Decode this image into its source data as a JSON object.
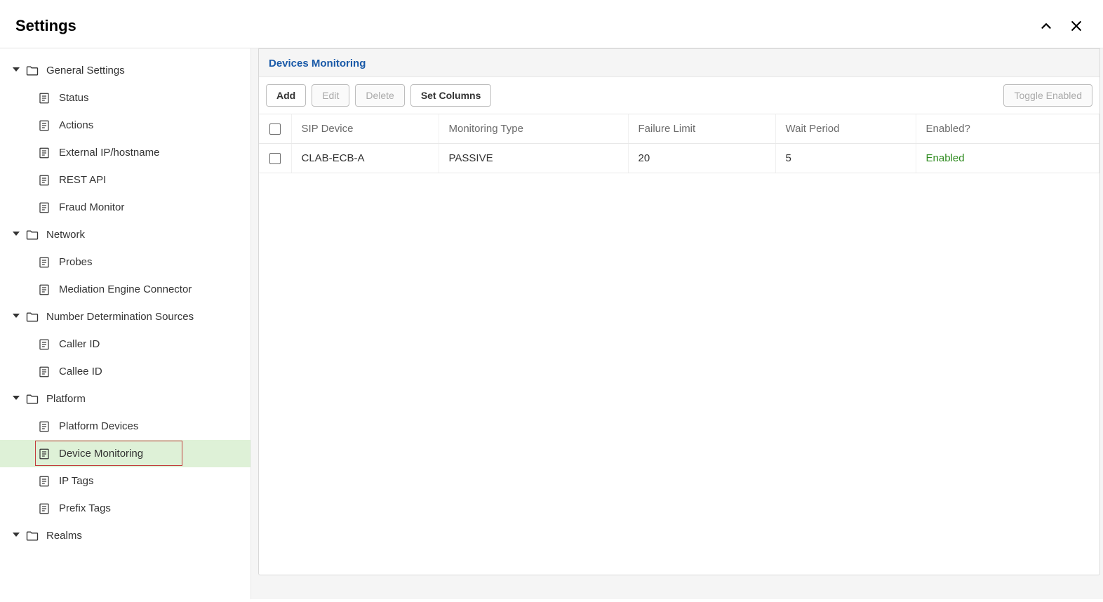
{
  "header": {
    "title": "Settings"
  },
  "sidebar": {
    "groups": [
      {
        "label": "General Settings",
        "children": [
          {
            "label": "Status"
          },
          {
            "label": "Actions"
          },
          {
            "label": "External IP/hostname"
          },
          {
            "label": "REST API"
          },
          {
            "label": "Fraud Monitor"
          }
        ]
      },
      {
        "label": "Network",
        "children": [
          {
            "label": "Probes"
          },
          {
            "label": "Mediation Engine Connector"
          }
        ]
      },
      {
        "label": "Number Determination Sources",
        "children": [
          {
            "label": "Caller ID"
          },
          {
            "label": "Callee ID"
          }
        ]
      },
      {
        "label": "Platform",
        "children": [
          {
            "label": "Platform Devices"
          },
          {
            "label": "Device Monitoring",
            "selected": true
          },
          {
            "label": "IP Tags"
          },
          {
            "label": "Prefix Tags"
          }
        ]
      },
      {
        "label": "Realms",
        "children": []
      }
    ]
  },
  "panel": {
    "title": "Devices Monitoring",
    "toolbar": {
      "add": "Add",
      "edit": "Edit",
      "delete": "Delete",
      "set_columns": "Set Columns",
      "toggle_enabled": "Toggle Enabled"
    },
    "columns": {
      "sip_device": "SIP Device",
      "monitoring_type": "Monitoring Type",
      "failure_limit": "Failure Limit",
      "wait_period": "Wait Period",
      "enabled": "Enabled?"
    },
    "rows": [
      {
        "sip_device": "CLAB-ECB-A",
        "monitoring_type": "PASSIVE",
        "failure_limit": "20",
        "wait_period": "5",
        "enabled": "Enabled"
      }
    ]
  }
}
